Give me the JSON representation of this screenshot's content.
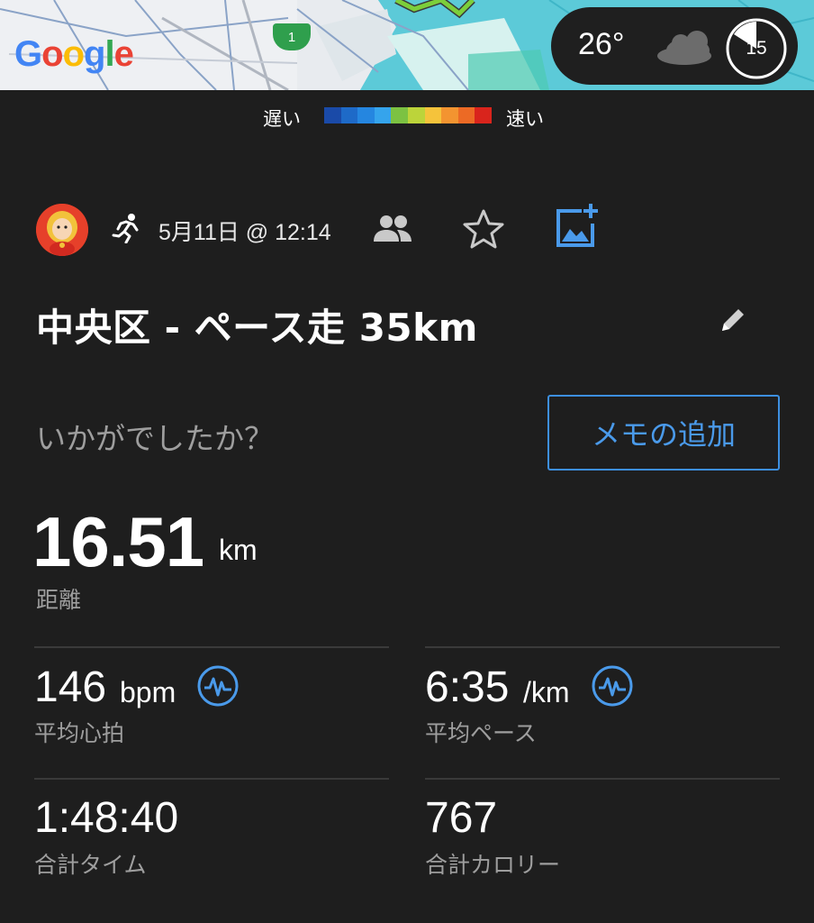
{
  "map": {
    "route_badge": "1",
    "google_logo": [
      "G",
      "o",
      "o",
      "g",
      "l",
      "e"
    ],
    "google_colors": [
      "#4285F4",
      "#EA4335",
      "#FBBC05",
      "#4285F4",
      "#34A853",
      "#EA4335"
    ]
  },
  "weather": {
    "temperature": "26°",
    "condition_icon": "cloud-icon",
    "timer_value": "15"
  },
  "pace_legend": {
    "slow_label": "遅い",
    "fast_label": "速い",
    "colors": [
      "#1a4aa8",
      "#1e6ac8",
      "#2586e0",
      "#35a4ec",
      "#7cc242",
      "#bcd43a",
      "#f5c33b",
      "#f39430",
      "#ec6a25",
      "#d9241c"
    ]
  },
  "activity": {
    "type_icon": "running-icon",
    "date": "5月11日 @ 12:14",
    "title": "中央区 - ペース走 35km",
    "prompt": "いかがでしたか？",
    "memo_button": "メモの追加"
  },
  "distance": {
    "value": "16.51",
    "unit": "km",
    "label": "距離"
  },
  "stats": {
    "heart_rate": {
      "value": "146",
      "unit": "bpm",
      "label": "平均心拍"
    },
    "pace": {
      "value": "6:35",
      "unit": "/km",
      "label": "平均ペース"
    },
    "time": {
      "value": "1:48:40",
      "label": "合計タイム"
    },
    "calories": {
      "value": "767",
      "label": "合計カロリー"
    }
  },
  "colors": {
    "background": "#1e1e1e",
    "accent_blue": "#3d8fe0",
    "secondary_text": "#9e9e9e"
  }
}
